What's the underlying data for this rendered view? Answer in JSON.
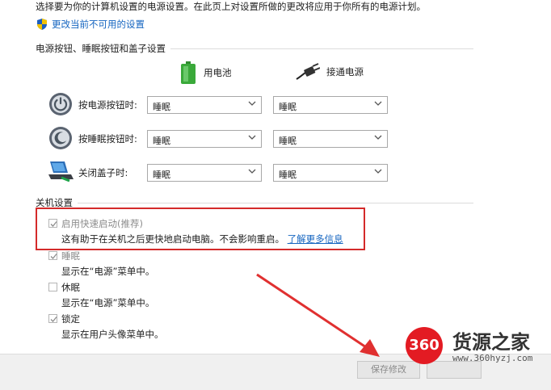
{
  "intro_text": "选择要为你的计算机设置的电源设置。在此页上对设置所做的更改将应用于你所有的电源计划。",
  "change_settings_link": "更改当前不可用的设置",
  "power_section": {
    "title": "电源按钮、睡眠按钮和盖子设置",
    "battery_label": "用电池",
    "plugged_label": "接通电源",
    "rows": [
      {
        "label": "按电源按钮时:",
        "battery": "睡眠",
        "plugged": "睡眠"
      },
      {
        "label": "按睡眠按钮时:",
        "battery": "睡眠",
        "plugged": "睡眠"
      },
      {
        "label": "关闭盖子时:",
        "battery": "睡眠",
        "plugged": "睡眠"
      }
    ]
  },
  "shutdown_section": {
    "title": "关机设置",
    "options": [
      {
        "label": "启用快速启动(推荐)",
        "desc": "这有助于在关机之后更快地启动电脑。不会影响重启。",
        "link": "了解更多信息",
        "checked": true
      },
      {
        "label": "睡眠",
        "desc": "显示在“电源”菜单中。",
        "checked": true
      },
      {
        "label": "休眠",
        "desc": "显示在“电源”菜单中。",
        "checked": false
      },
      {
        "label": "锁定",
        "desc": "显示在用户头像菜单中。",
        "checked": true
      }
    ]
  },
  "footer": {
    "save_button": "保存修改",
    "cancel_button": ""
  },
  "watermark": {
    "badge": "360",
    "name": "货源之家",
    "url": "www.360hyzj.com"
  },
  "colors": {
    "link": "#1565c0",
    "highlight": "#d42a2a",
    "arrow": "#e03030",
    "brand": "#e31b23"
  }
}
